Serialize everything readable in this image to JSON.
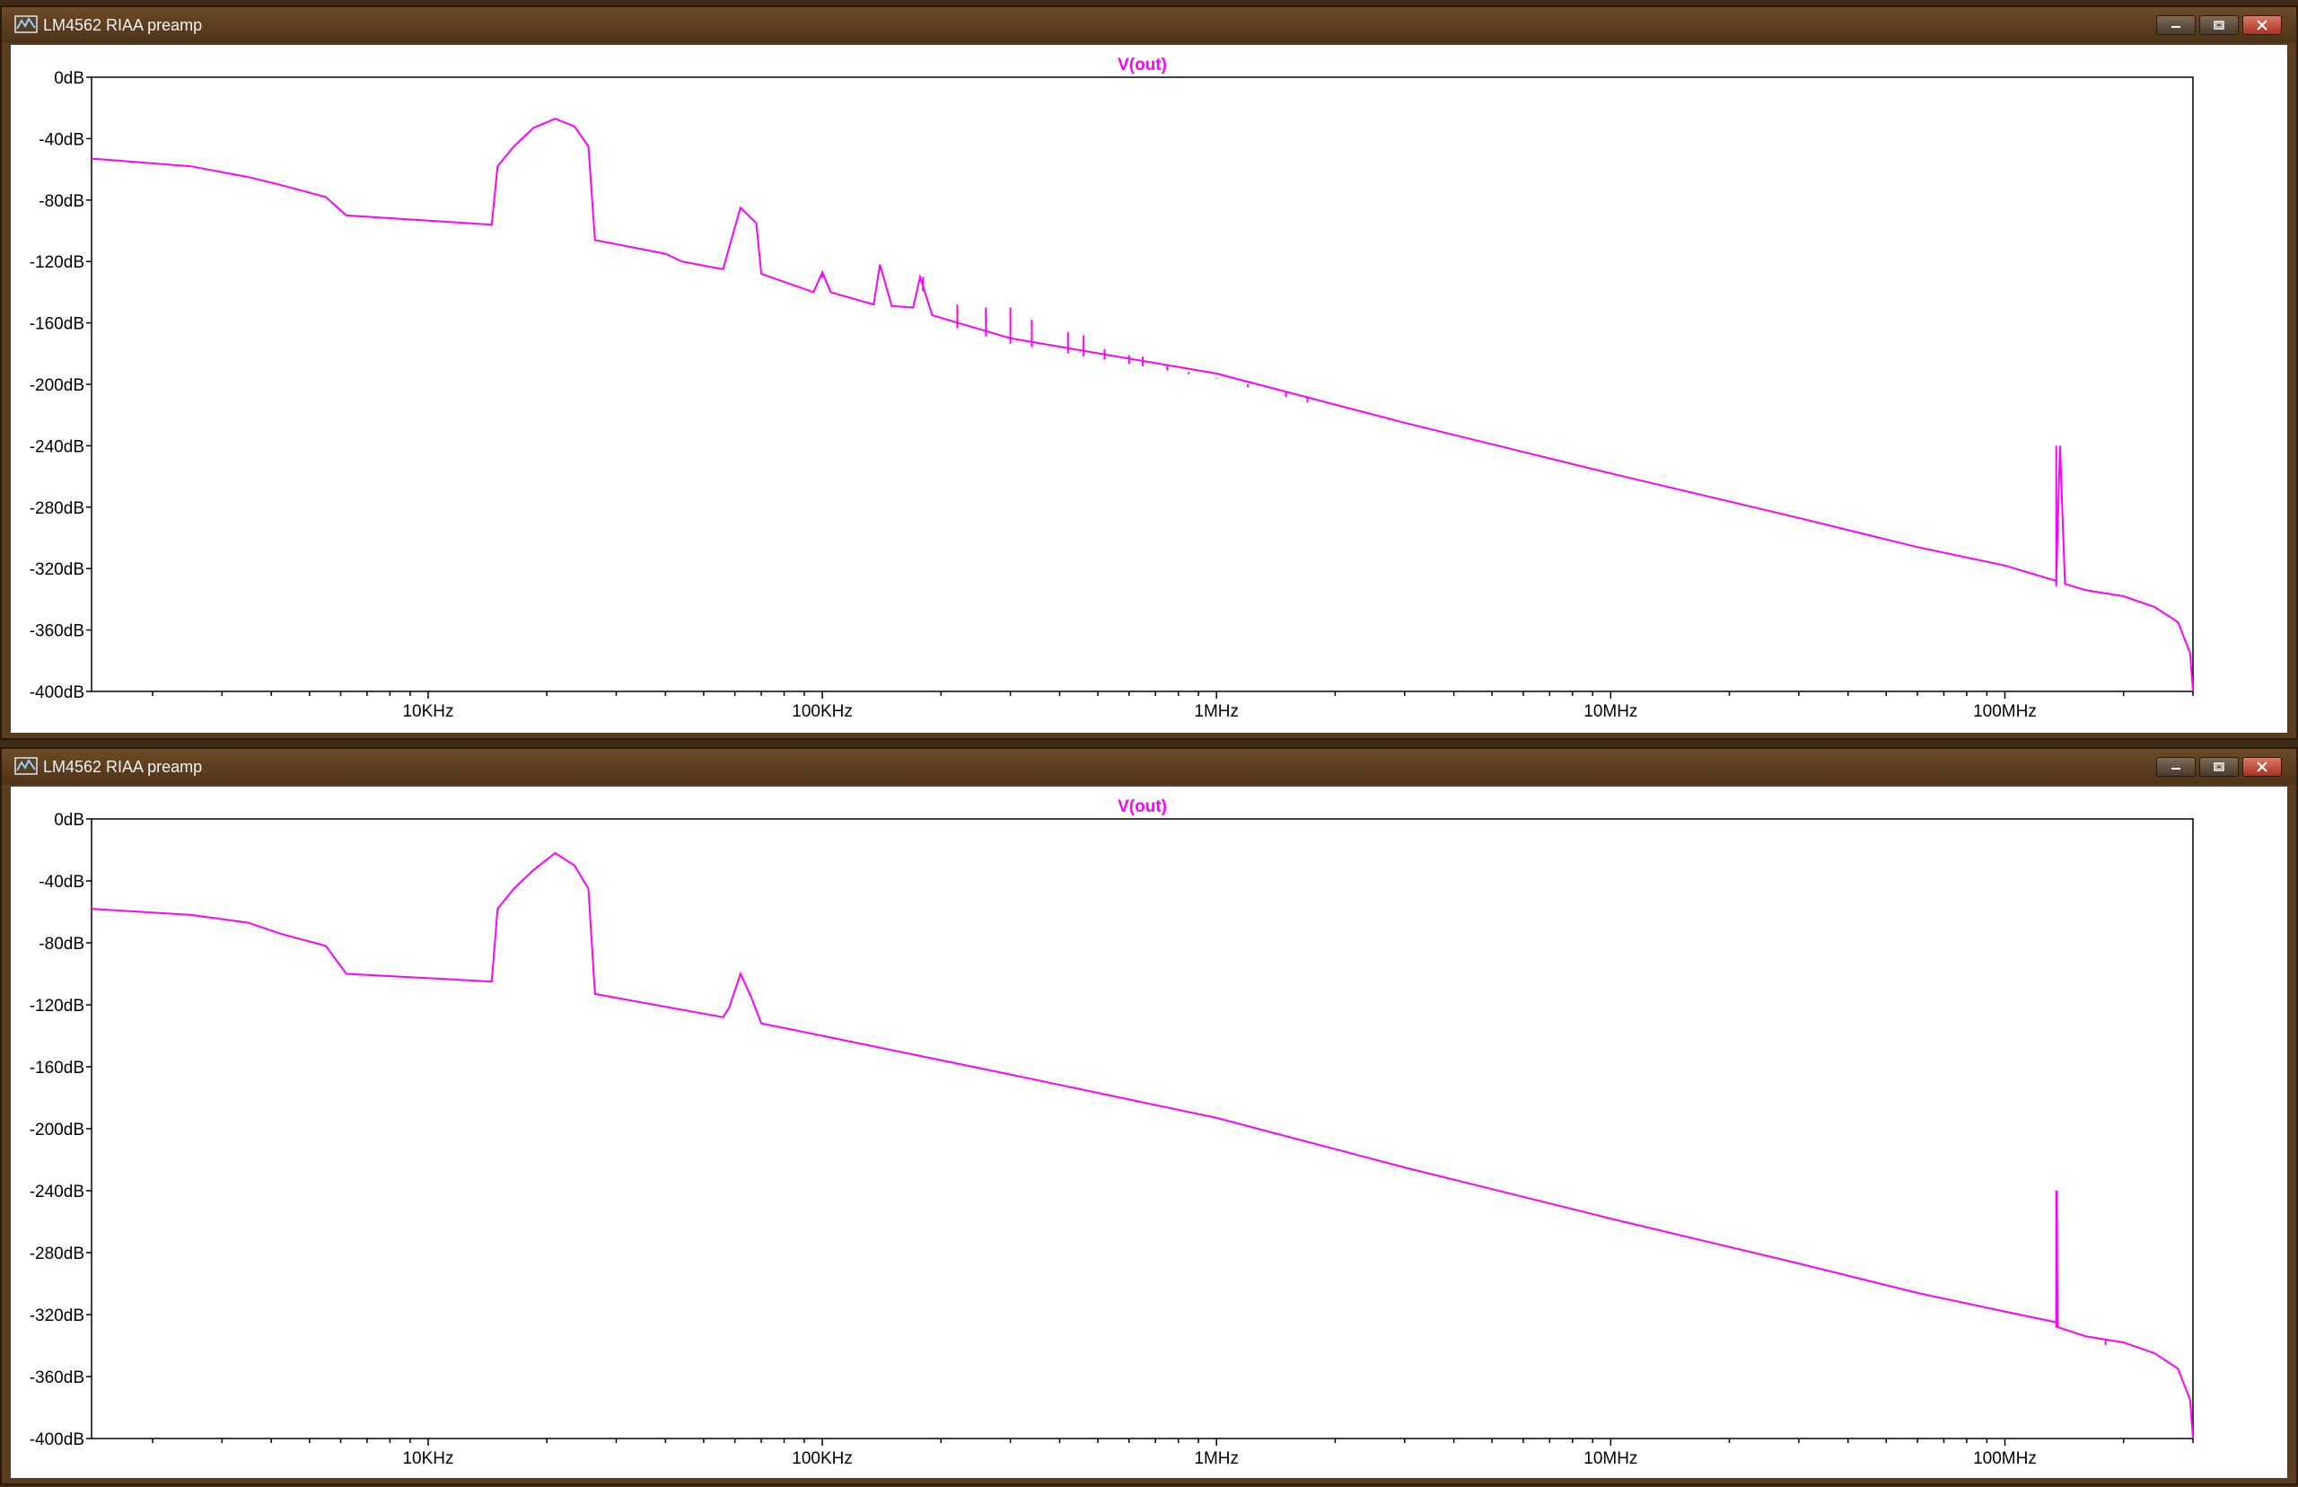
{
  "colors": {
    "trace": "#ff00ff",
    "frame": "#000000",
    "window_frame": "#5a3d20"
  },
  "window": {
    "title": "LM4562 RIAA preamp",
    "controls": [
      "minimize-icon",
      "maximize-icon",
      "close-icon"
    ]
  },
  "chart_data": [
    {
      "type": "line",
      "trace_label": "V(out)",
      "x_scale": "log",
      "x_range": [
        1400,
        300000000
      ],
      "y_range": [
        -400,
        0
      ],
      "y_ticks": [
        "0dB",
        "-40dB",
        "-80dB",
        "-120dB",
        "-160dB",
        "-200dB",
        "-240dB",
        "-280dB",
        "-320dB",
        "-360dB",
        "-400dB"
      ],
      "x_ticks": [
        "10KHz",
        "100KHz",
        "1MHz",
        "10MHz",
        "100MHz"
      ],
      "x_tick_values": [
        10000,
        100000,
        1000000,
        10000000,
        100000000
      ],
      "series": [
        {
          "x": [
            1400,
            2500,
            3500,
            4200,
            5500,
            6200,
            14500,
            15000,
            16500,
            18500,
            21000,
            23500,
            25500,
            26500,
            40000,
            44000,
            56000,
            62000,
            68000,
            70000,
            95000,
            100000,
            105000,
            135000,
            140000,
            150000,
            170000,
            177000,
            190000,
            300000,
            1000000,
            3000000,
            10000000,
            30000000,
            60000000,
            100000000,
            135000000,
            138000000,
            142000000,
            160000000,
            200000000,
            240000000,
            275000000,
            295000000,
            300000000
          ],
          "y": [
            -53,
            -58,
            -65,
            -70,
            -78,
            -90,
            -96,
            -58,
            -45,
            -33,
            -27,
            -32,
            -45,
            -106,
            -115,
            -120,
            -125,
            -85,
            -95,
            -128,
            -140,
            -127,
            -140,
            -148,
            -122,
            -149,
            -150,
            -130,
            -155,
            -170,
            -193,
            -225,
            -258,
            -287,
            -306,
            -318,
            -328,
            -240,
            -330,
            -334,
            -338,
            -345,
            -355,
            -375,
            -400
          ]
        }
      ],
      "spurs": [
        {
          "x": 100000,
          "y": -128
        },
        {
          "x": 140000,
          "y": -122
        },
        {
          "x": 180000,
          "y": -130
        },
        {
          "x": 220000,
          "y": -148
        },
        {
          "x": 260000,
          "y": -150
        },
        {
          "x": 300000,
          "y": -150
        },
        {
          "x": 340000,
          "y": -158
        },
        {
          "x": 420000,
          "y": -166
        },
        {
          "x": 460000,
          "y": -168
        },
        {
          "x": 520000,
          "y": -177
        },
        {
          "x": 600000,
          "y": -181
        },
        {
          "x": 650000,
          "y": -182
        },
        {
          "x": 750000,
          "y": -188
        },
        {
          "x": 850000,
          "y": -192
        },
        {
          "x": 1000000,
          "y": -196
        },
        {
          "x": 1200000,
          "y": -200
        },
        {
          "x": 1500000,
          "y": -205
        },
        {
          "x": 1700000,
          "y": -208
        },
        {
          "x": 135000000,
          "y": -240
        }
      ]
    },
    {
      "type": "line",
      "trace_label": "V(out)",
      "x_scale": "log",
      "x_range": [
        1400,
        300000000
      ],
      "y_range": [
        -400,
        0
      ],
      "y_ticks": [
        "0dB",
        "-40dB",
        "-80dB",
        "-120dB",
        "-160dB",
        "-200dB",
        "-240dB",
        "-280dB",
        "-320dB",
        "-360dB",
        "-400dB"
      ],
      "x_ticks": [
        "10KHz",
        "100KHz",
        "1MHz",
        "10MHz",
        "100MHz"
      ],
      "x_tick_values": [
        10000,
        100000,
        1000000,
        10000000,
        100000000
      ],
      "series": [
        {
          "x": [
            1400,
            2500,
            3500,
            4200,
            5500,
            6200,
            14500,
            15000,
            16500,
            18500,
            21000,
            23500,
            25500,
            26500,
            56000,
            58000,
            62000,
            66000,
            70000,
            100000,
            300000,
            1000000,
            3000000,
            10000000,
            30000000,
            60000000,
            100000000,
            135000000,
            135500000,
            136000000,
            160000000,
            200000000,
            240000000,
            275000000,
            295000000,
            300000000
          ],
          "y": [
            -58,
            -62,
            -67,
            -74,
            -82,
            -100,
            -105,
            -58,
            -45,
            -33,
            -22,
            -30,
            -45,
            -113,
            -128,
            -122,
            -100,
            -115,
            -132,
            -140,
            -165,
            -193,
            -225,
            -258,
            -287,
            -306,
            -318,
            -325,
            -240,
            -328,
            -334,
            -338,
            -345,
            -355,
            -375,
            -400
          ]
        }
      ],
      "spurs": [
        {
          "x": 135000000,
          "y": -240
        },
        {
          "x": 180000000,
          "y": -336
        }
      ]
    }
  ]
}
